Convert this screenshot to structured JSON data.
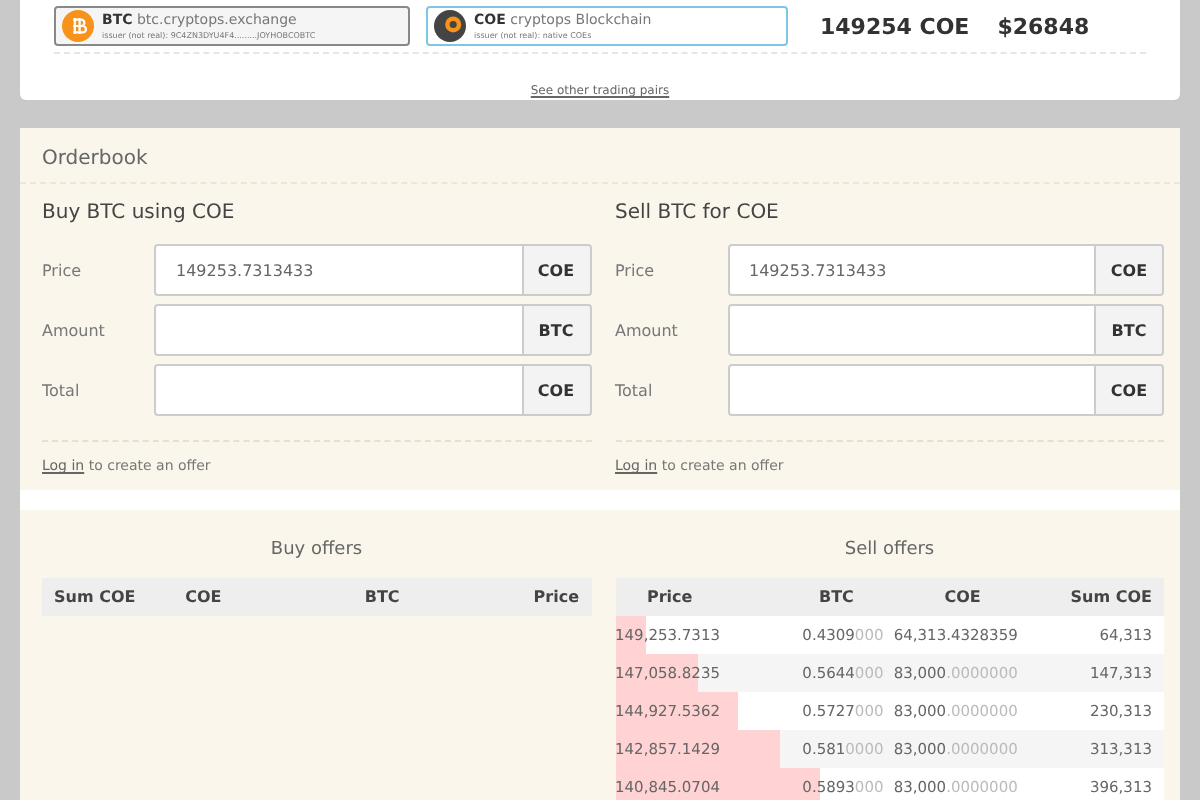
{
  "pairs": [
    {
      "kind": "btc",
      "code": "BTC",
      "domain": "btc.cryptops.exchange",
      "issuer": "issuer (not real): 9C4ZN3DYU4F4.........JOYHOBCOBTC",
      "selected": false
    },
    {
      "kind": "coe",
      "code": "COE",
      "domain": "cryptops Blockchain",
      "issuer": "issuer (not real): native COEs",
      "selected": true
    }
  ],
  "price": {
    "coe": "149254 COE",
    "usd": "$26848"
  },
  "other_pairs_link": "See other trading pairs",
  "orderbook": {
    "title": "Orderbook",
    "forms": [
      {
        "title": "Buy BTC using COE",
        "fields": [
          {
            "label": "Price",
            "value": "149253.7313433",
            "unit": "COE"
          },
          {
            "label": "Amount",
            "unit": "BTC"
          },
          {
            "label": "Total",
            "unit": "COE"
          }
        ],
        "login_link": "Log in",
        "login_text": "to create an offer"
      },
      {
        "title": "Sell BTC for COE",
        "fields": [
          {
            "label": "Price",
            "value": "149253.7313433",
            "unit": "COE"
          },
          {
            "label": "Amount",
            "unit": "BTC"
          },
          {
            "label": "Total",
            "unit": "COE"
          }
        ],
        "login_link": "Log in",
        "login_text": "to create an offer"
      }
    ],
    "buy_offers": {
      "title": "Buy offers",
      "columns": [
        "Sum COE",
        "COE",
        "BTC",
        "Price"
      ]
    },
    "sell_offers": {
      "title": "Sell offers",
      "columns": [
        "Price",
        "BTC",
        "COE",
        "Sum COE"
      ],
      "rows": [
        {
          "price": "149,253.7313",
          "btc": "0.4309",
          "btc_pad": "000",
          "coe": "64,313.4328359",
          "sum": "64,313",
          "level": 0.055
        },
        {
          "price": "147,058.8235",
          "btc": "0.5644",
          "btc_pad": "000",
          "coe": "83,000",
          "coe_pad": ".0000000",
          "sum": "147,313",
          "level": 0.15
        },
        {
          "price": "144,927.5362",
          "btc": "0.5727",
          "btc_pad": "000",
          "coe": "83,000",
          "coe_pad": ".0000000",
          "sum": "230,313",
          "level": 0.225
        },
        {
          "price": "142,857.1429",
          "btc": "0.581",
          "btc_pad": "0000",
          "coe": "83,000",
          "coe_pad": ".0000000",
          "sum": "313,313",
          "level": 0.3
        },
        {
          "price": "140,845.0704",
          "btc": "0.5893",
          "btc_pad": "000",
          "coe": "83,000",
          "coe_pad": ".0000000",
          "sum": "396,313",
          "level": 0.375
        }
      ]
    }
  }
}
